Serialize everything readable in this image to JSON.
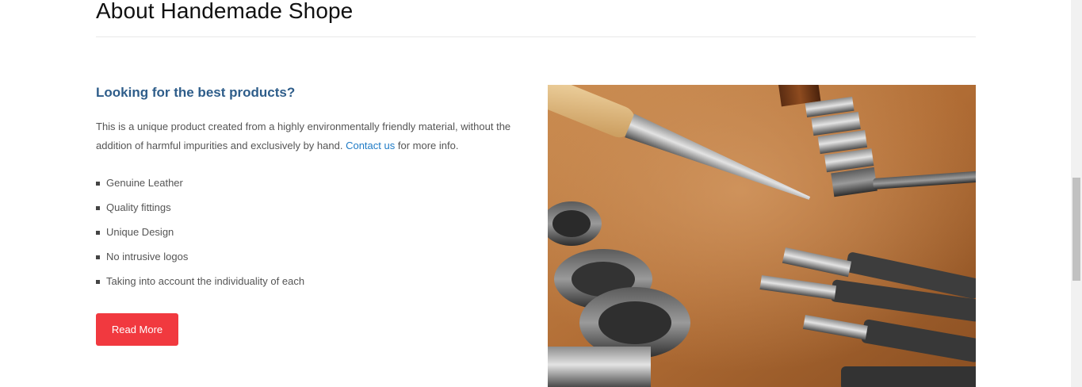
{
  "section": {
    "title": "About Handemade Shope"
  },
  "content": {
    "subheading": "Looking for the best products?",
    "description_text": "This is a unique product created from a highly environmentally friendly material, without the addition of harmful impurities and exclusively by hand.",
    "contact_link_label": "Contact us",
    "description_suffix": "for more info.",
    "features": [
      "Genuine Leather",
      "Quality fittings",
      "Unique Design",
      "No intrusive logos",
      "Taking into account the individuality of each"
    ],
    "read_more_label": "Read More"
  },
  "image": {
    "subject": "leather crafting tools on leather surface",
    "icon": "photo"
  },
  "colors": {
    "subheading": "#2e5d8a",
    "link": "#1f7bc6",
    "button": "#f1393f",
    "body_text": "#555555",
    "title": "#111111"
  }
}
